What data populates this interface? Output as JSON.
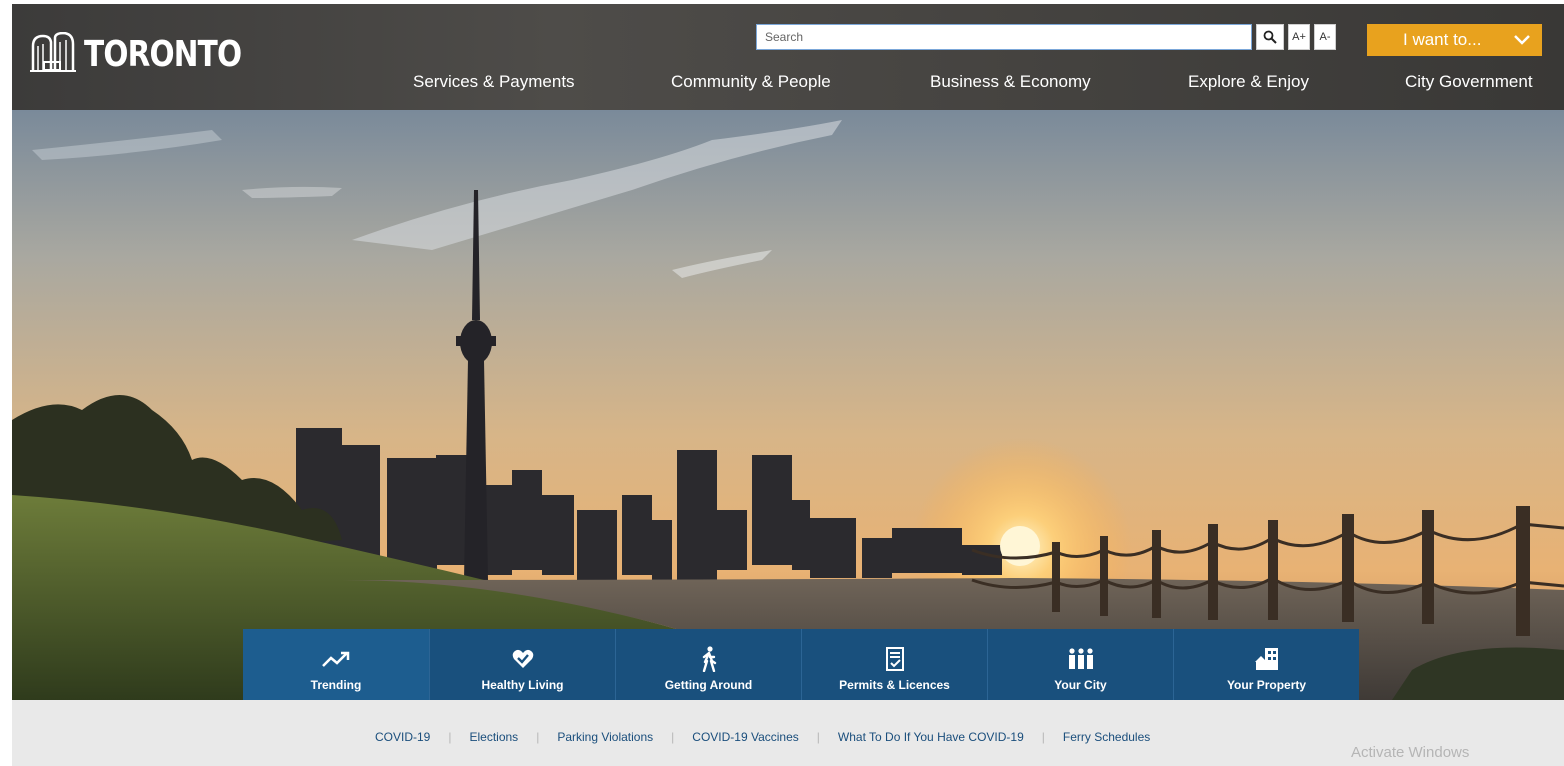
{
  "header": {
    "logo_text": "TORONTO",
    "search": {
      "placeholder": "Search",
      "value": ""
    },
    "font_increase_label": "A+",
    "font_decrease_label": "A-",
    "i_want_to_label": "I want to...",
    "nav": [
      "Services & Payments",
      "Community & People",
      "Business & Economy",
      "Explore & Enjoy",
      "City Government"
    ]
  },
  "icons": {
    "search": "search-icon",
    "dropdown": "chevron-down-icon",
    "trending": "trending-icon",
    "healthy_living": "heart-icon",
    "getting_around": "walking-person-icon",
    "permits": "checklist-document-icon",
    "your_city": "people-icon",
    "your_property": "house-building-icon"
  },
  "tabs": [
    {
      "label": "Trending",
      "active": true
    },
    {
      "label": "Healthy Living"
    },
    {
      "label": "Getting Around"
    },
    {
      "label": "Permits & Licences"
    },
    {
      "label": "Your City"
    },
    {
      "label": "Your Property"
    }
  ],
  "quick_links": [
    "COVID-19",
    "Elections",
    "Parking Violations",
    "COVID-19 Vaccines",
    "What To Do If You Have COVID-19",
    "Ferry Schedules"
  ],
  "os_watermark": "Activate Windows",
  "colors": {
    "accent": "#e8a21e",
    "tab_blue": "#19507d",
    "link_blue": "#1a4e7c",
    "header_dark": "#454340"
  }
}
